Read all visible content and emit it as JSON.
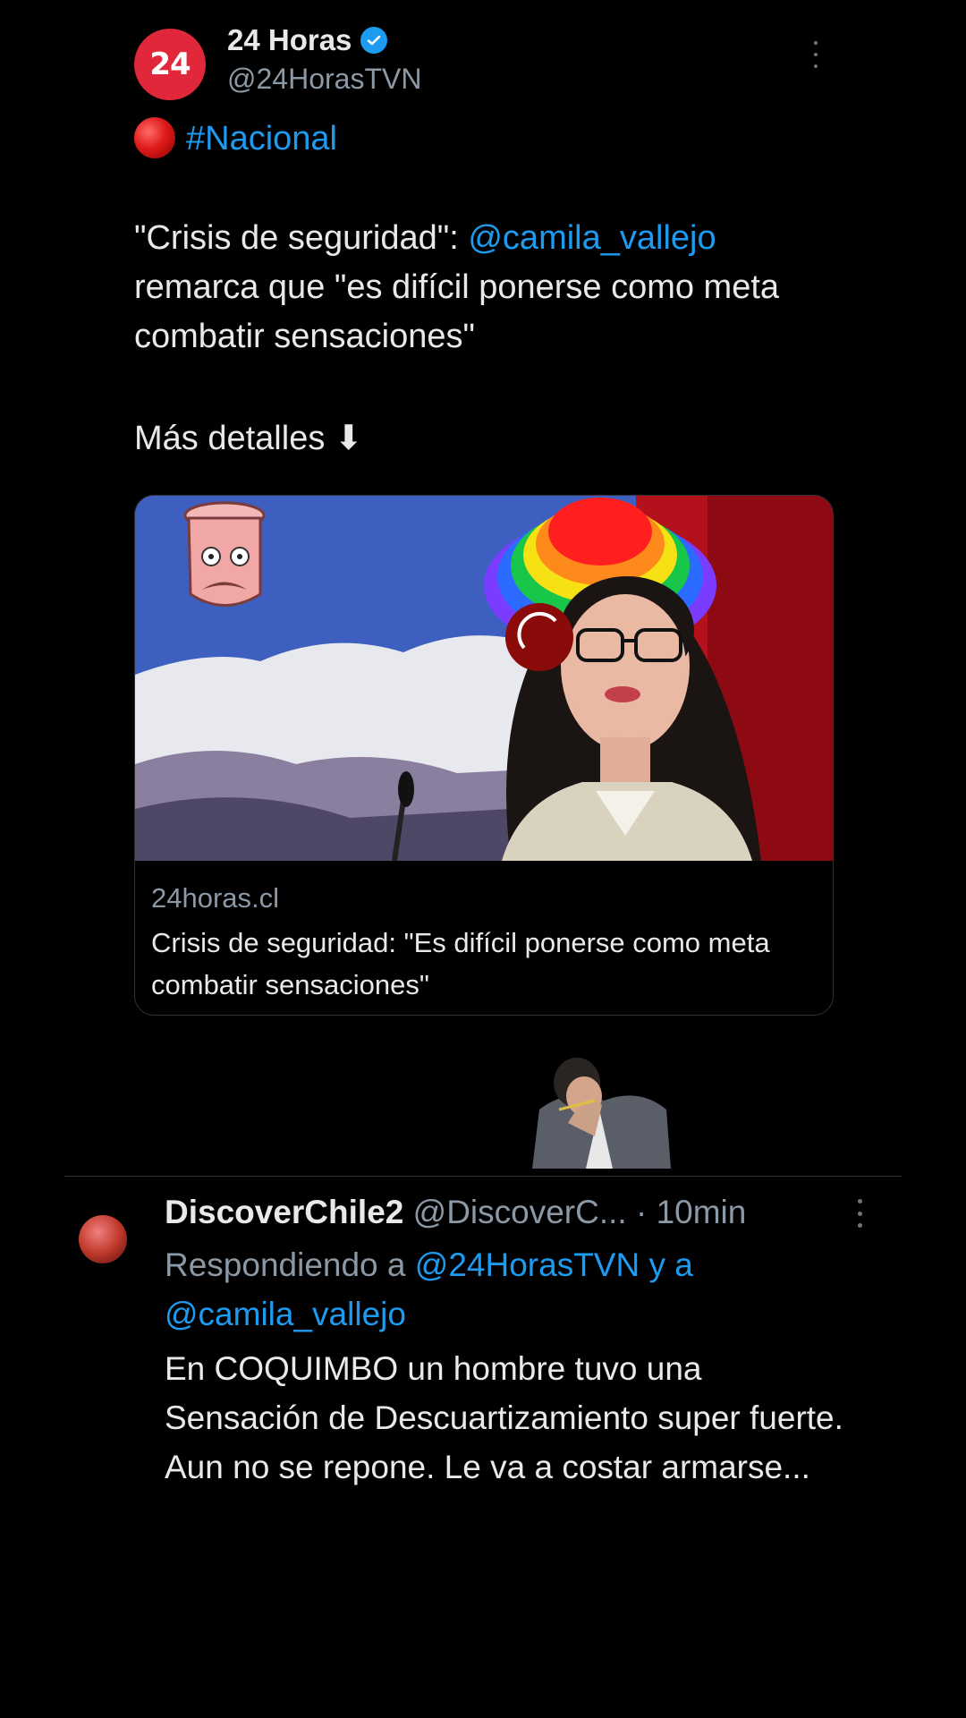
{
  "tweet": {
    "avatar_text": "24",
    "display_name": "24 Horas",
    "handle": "@24HorasTVN",
    "hashtag": "#Nacional",
    "text_quote": "\"Crisis de seguridad\": ",
    "text_mention": "@camila_vallejo",
    "text_rest": " remarca que \"es difícil ponerse como meta combatir sensaciones\"",
    "more_details": "Más detalles ⬇"
  },
  "card": {
    "domain": "24horas.cl",
    "title": "Crisis de seguridad: \"Es difícil ponerse como meta combatir sensaciones\""
  },
  "reply": {
    "display_name": "DiscoverChile2",
    "handle": "@DiscoverC...",
    "time": "· 10min",
    "replying_prefix": "Respondiendo a ",
    "replying_mention_1": "@24HorasTVN",
    "replying_join": " y a",
    "replying_mention_2": "@camila_vallejo",
    "text": "En COQUIMBO un hombre tuvo una Sensación de Descuartizamiento super fuerte. Aun no se repone. Le va a costar armarse..."
  },
  "colors": {
    "background": "#000000",
    "text": "#e7e9ea",
    "secondary_text": "#8b98a5",
    "link": "#1d9bf0",
    "brand_24horas": "#e0283a"
  },
  "icons": [
    "verified-badge-icon",
    "more-vertical-icon",
    "red-ball-emoji",
    "arrow-down-emoji",
    "spinner-icon"
  ]
}
